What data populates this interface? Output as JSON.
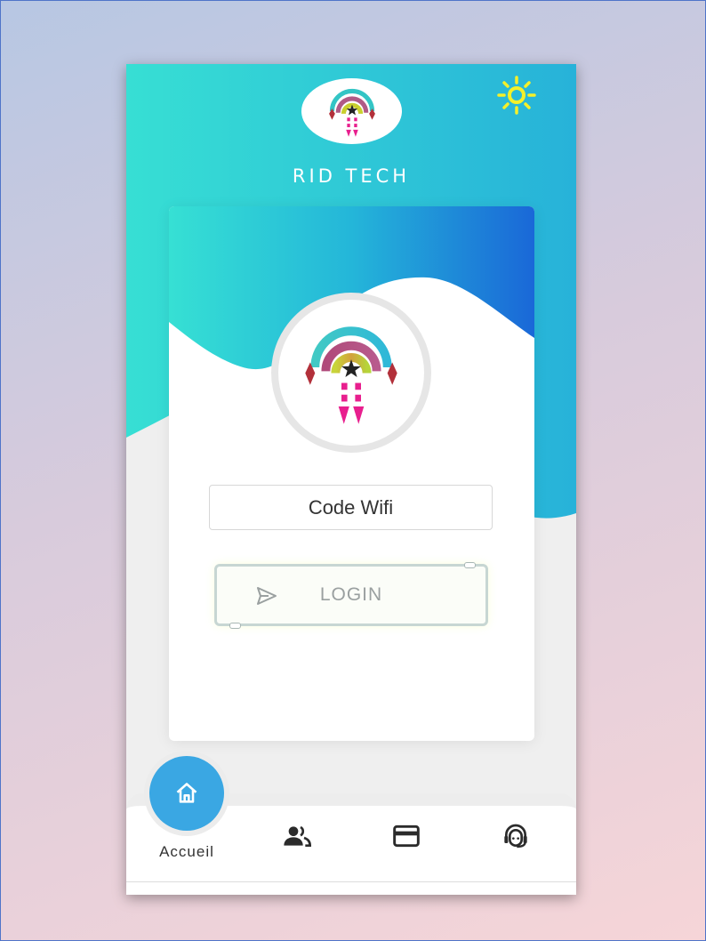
{
  "app": {
    "title": "RID TECH"
  },
  "form": {
    "code_placeholder": "Code Wifi",
    "login_label": "LOGIN"
  },
  "nav": {
    "items": [
      {
        "label": "Accueil",
        "icon": "home-icon"
      },
      {
        "label": "",
        "icon": "users-icon"
      },
      {
        "label": "",
        "icon": "credit-card-icon"
      },
      {
        "label": "",
        "icon": "support-agent-icon"
      }
    ]
  },
  "colors": {
    "accent_teal": "#37dfd4",
    "accent_blue": "#1a6fd8",
    "home_button": "#3aa7e3",
    "sun": "#f4f02a"
  }
}
